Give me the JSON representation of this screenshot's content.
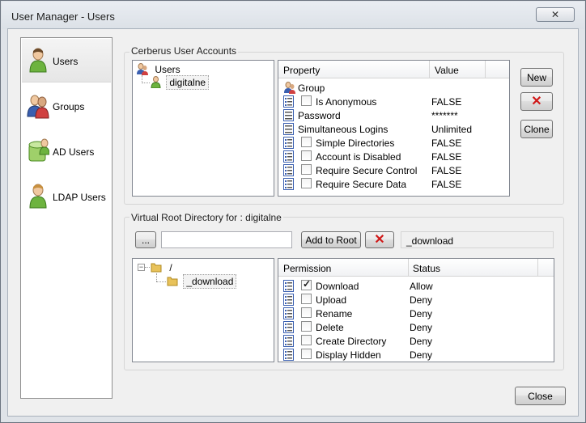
{
  "window": {
    "title": "User Manager - Users",
    "close_label": "✕"
  },
  "nav": {
    "items": [
      {
        "label": "Users",
        "icon": "user-icon"
      },
      {
        "label": "Groups",
        "icon": "group-icon"
      },
      {
        "label": "AD Users",
        "icon": "ad-users-icon"
      },
      {
        "label": "LDAP Users",
        "icon": "ldap-user-icon"
      }
    ]
  },
  "accounts": {
    "group_label": "Cerberus User Accounts",
    "tree": {
      "root": "Users",
      "child": "digitalne"
    },
    "properties": {
      "columns": [
        "Property",
        "Value"
      ],
      "rows": [
        {
          "name": "Group",
          "value": "",
          "icon": "group-icon",
          "checkbox": false
        },
        {
          "name": "Is Anonymous",
          "value": "FALSE",
          "icon": "property-icon",
          "checkbox": true
        },
        {
          "name": "Password",
          "value": "*******",
          "icon": "property-icon",
          "checkbox": false
        },
        {
          "name": "Simultaneous Logins",
          "value": "Unlimited",
          "icon": "property-icon",
          "checkbox": false
        },
        {
          "name": "Simple Directories",
          "value": "FALSE",
          "icon": "property-icon",
          "checkbox": true
        },
        {
          "name": "Account is Disabled",
          "value": "FALSE",
          "icon": "property-icon",
          "checkbox": true
        },
        {
          "name": "Require Secure Control",
          "value": "FALSE",
          "icon": "property-icon",
          "checkbox": true
        },
        {
          "name": "Require Secure Data",
          "value": "FALSE",
          "icon": "property-icon",
          "checkbox": true
        }
      ]
    },
    "buttons": {
      "new": "New",
      "delete": "✕",
      "clone": "Clone"
    }
  },
  "vroot": {
    "group_label": "Virtual Root Directory for : digitalne",
    "browse_label": "...",
    "path_value": "",
    "add_label": "Add to Root",
    "delete_label": "✕",
    "selected_dir": "_download",
    "tree": {
      "root": "/",
      "child": "_download"
    },
    "permissions": {
      "columns": [
        "Permission",
        "Status"
      ],
      "rows": [
        {
          "name": "Download",
          "status": "Allow",
          "checked": true
        },
        {
          "name": "Upload",
          "status": "Deny",
          "checked": false
        },
        {
          "name": "Rename",
          "status": "Deny",
          "checked": false
        },
        {
          "name": "Delete",
          "status": "Deny",
          "checked": false
        },
        {
          "name": "Create Directory",
          "status": "Deny",
          "checked": false
        },
        {
          "name": "Display Hidden",
          "status": "Deny",
          "checked": false
        }
      ]
    }
  },
  "footer": {
    "close_label": "Close"
  },
  "colors": {
    "delete_red": "#d01818",
    "folder_yellow": "#e8c25a",
    "user_green": "#6db33f"
  }
}
